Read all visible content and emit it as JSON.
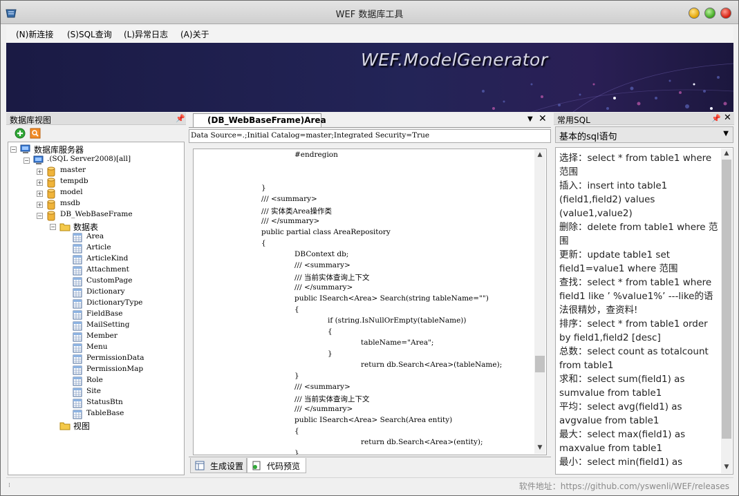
{
  "window": {
    "title": "WEF 数据库工具"
  },
  "menu": [
    {
      "label": "(N)新连接"
    },
    {
      "label": "(S)SQL查询"
    },
    {
      "label": "(L)异常日志"
    },
    {
      "label": "(A)关于"
    }
  ],
  "banner": {
    "title": "WEF.ModelGenerator"
  },
  "left_panel": {
    "title": "数据库视图",
    "tree": {
      "root": "数据库服务器",
      "server": ".(SQL Server2008)[all]",
      "databases": [
        "master",
        "tempdb",
        "model",
        "msdb",
        "DB_WebBaseFrame"
      ],
      "tables_folder": "数据表",
      "tables": [
        "Area",
        "Article",
        "ArticleKind",
        "Attachment",
        "CustomPage",
        "Dictionary",
        "DictionaryType",
        "FieldBase",
        "MailSetting",
        "Member",
        "Menu",
        "PermissionData",
        "PermissionMap",
        "Role",
        "Site",
        "StatusBtn",
        "TableBase"
      ],
      "views_folder": "视图"
    }
  },
  "center_panel": {
    "tab_title": "(DB_WebBaseFrame)Area",
    "connection_string": "Data Source=.;Initial Catalog=master;Integrated Security=True",
    "code_lines": [
      {
        "indent": 2,
        "text": "#endregion"
      },
      {
        "indent": 0,
        "text": ""
      },
      {
        "indent": 0,
        "text": ""
      },
      {
        "indent": 1,
        "text": "}"
      },
      {
        "indent": 1,
        "text": "/// <summary>"
      },
      {
        "indent": 1,
        "text": "/// 实体类Area操作类"
      },
      {
        "indent": 1,
        "text": "/// </summary>"
      },
      {
        "indent": 1,
        "text": "public partial class AreaRepository"
      },
      {
        "indent": 1,
        "text": "{"
      },
      {
        "indent": 2,
        "text": "DBContext db;"
      },
      {
        "indent": 2,
        "text": "/// <summary>"
      },
      {
        "indent": 2,
        "text": "/// 当前实体查询上下文"
      },
      {
        "indent": 2,
        "text": "/// </summary>"
      },
      {
        "indent": 2,
        "text": "public ISearch<Area> Search(string tableName=\"\")"
      },
      {
        "indent": 2,
        "text": "{"
      },
      {
        "indent": 3,
        "text": "if (string.IsNullOrEmpty(tableName))"
      },
      {
        "indent": 3,
        "text": "{"
      },
      {
        "indent": 4,
        "text": "tableName=\"Area\";"
      },
      {
        "indent": 3,
        "text": "}"
      },
      {
        "indent": 4,
        "text": "return db.Search<Area>(tableName);"
      },
      {
        "indent": 2,
        "text": "}"
      },
      {
        "indent": 2,
        "text": "/// <summary>"
      },
      {
        "indent": 2,
        "text": "/// 当前实体查询上下文"
      },
      {
        "indent": 2,
        "text": "/// </summary>"
      },
      {
        "indent": 2,
        "text": "public ISearch<Area> Search(Area entity)"
      },
      {
        "indent": 2,
        "text": "{"
      },
      {
        "indent": 4,
        "text": "return db.Search<Area>(entity);"
      },
      {
        "indent": 2,
        "text": "}"
      }
    ],
    "bottom_tabs": [
      "生成设置",
      "代码预览"
    ]
  },
  "right_panel": {
    "title": "常用SQL",
    "combo_value": "基本的sql语句",
    "sql_text": "选择：select * from table1 where 范围\n插入：insert into table1 (field1,field2) values (value1,value2)\n删除：delete from table1 where 范围\n更新：update table1 set field1=value1 where 范围\n查找：select * from table1 where field1 like ’ %value1%’ ---like的语法很精妙，查资料!\n排序：select * from table1 order by field1,field2 [desc]\n总数：select count as totalcount from table1\n求和：select sum(field1) as sumvalue from table1\n平均：select avg(field1) as avgvalue from table1\n最大：select max(field1) as maxvalue from table1\n最小：select min(field1) as"
  },
  "status": {
    "url": "软件地址：https://github.com/yswenli/WEF/releases"
  },
  "icons": {
    "app": "app-logo-icon",
    "add": "add-connection-icon",
    "refresh": "refresh-icon",
    "server": "server-icon",
    "database": "database-icon",
    "folder": "folder-icon",
    "table": "table-icon"
  },
  "colors": {
    "banner_bg": "#1e1f4c",
    "min_btn": "#e3a300",
    "max_btn": "#3ea51f",
    "close_btn": "#d21b0c"
  }
}
